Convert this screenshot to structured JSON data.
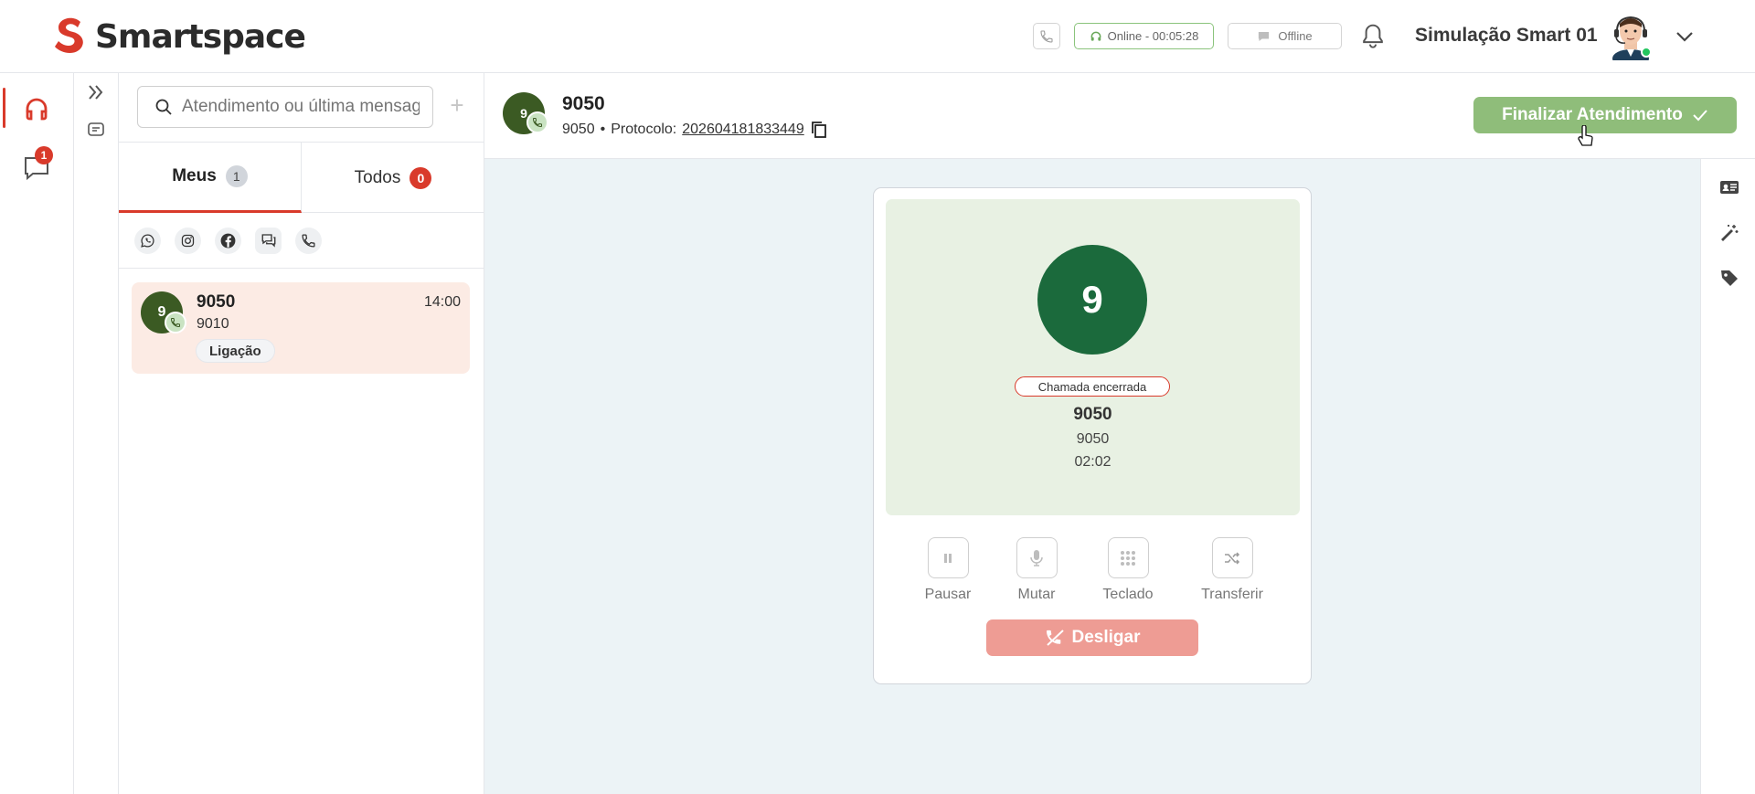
{
  "brand": {
    "name": "Smartspace",
    "color": "#d93a2b"
  },
  "header": {
    "status_online": "Online - 00:05:28",
    "status_offline": "Offline",
    "user_name": "Simulação Smart 01"
  },
  "rail": {
    "chat_badge": "1"
  },
  "list": {
    "search_placeholder": "Atendimento ou última mensagem",
    "plus": "+",
    "tabs": [
      {
        "label": "Meus",
        "count": "1"
      },
      {
        "label": "Todos",
        "count": "0"
      }
    ],
    "channels": [
      "whatsapp-icon",
      "instagram-icon",
      "facebook-icon",
      "chat-icon",
      "phone-icon"
    ],
    "conversation": {
      "avatar": "9",
      "title": "9050",
      "time": "14:00",
      "subtitle": "9010",
      "tag": "Ligação"
    }
  },
  "main": {
    "avatar": "9",
    "title": "9050",
    "subtitle_number": "9050",
    "separator": "•",
    "protocol_label": "Protocolo:",
    "protocol_value": "202604181833449",
    "finish_button": "Finalizar Atendimento"
  },
  "call": {
    "avatar": "9",
    "status": "Chamada encerrada",
    "name": "9050",
    "number": "9050",
    "duration": "02:02",
    "controls": [
      {
        "label": "Pausar",
        "icon": "pause-icon"
      },
      {
        "label": "Mutar",
        "icon": "mic-icon"
      },
      {
        "label": "Teclado",
        "icon": "keypad-icon"
      },
      {
        "label": "Transferir",
        "icon": "shuffle-icon"
      }
    ],
    "hangup_label": "Desligar"
  },
  "colors": {
    "accent_red": "#d93a2b",
    "finish_green": "#8fbd7a",
    "call_avatar": "#1b6a3c",
    "hangup": "#ee9c94"
  }
}
